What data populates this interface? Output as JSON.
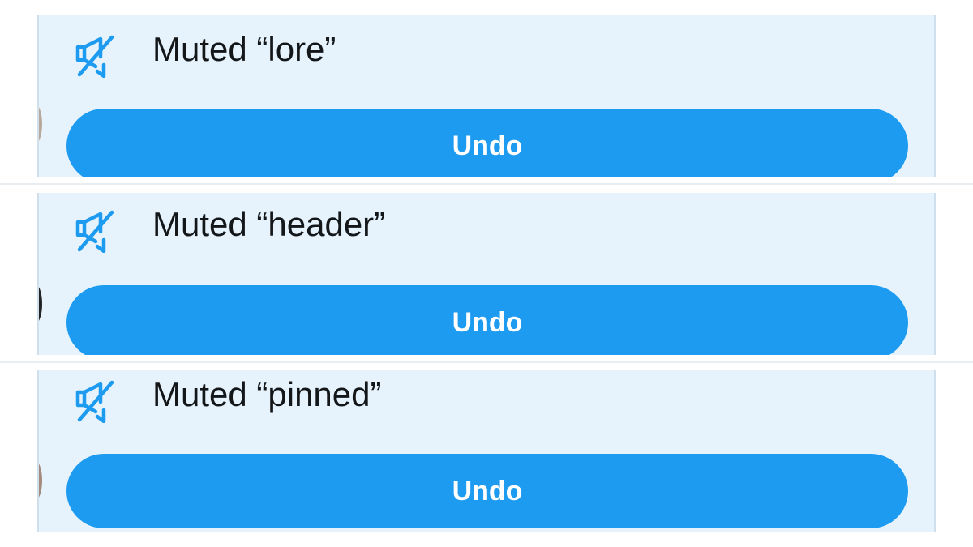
{
  "notifications": [
    {
      "icon": "speaker-muted-icon",
      "text": "Muted “lore”",
      "button_label": "Undo"
    },
    {
      "icon": "speaker-muted-icon",
      "text": "Muted “header”",
      "button_label": "Undo"
    },
    {
      "icon": "speaker-muted-icon",
      "text": "Muted “pinned”",
      "button_label": "Undo"
    }
  ],
  "colors": {
    "accent": "#1d9bf0",
    "panel_background": "#e6f3fc",
    "text": "#14171a",
    "button_text": "#ffffff"
  }
}
